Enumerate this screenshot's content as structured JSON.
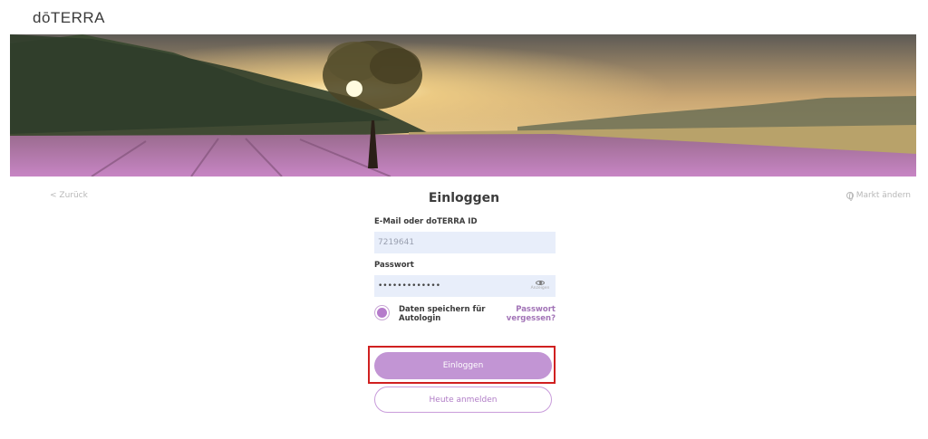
{
  "header": {
    "brand": "dōTERRA"
  },
  "hero": {
    "image": "lavender-field-sunset-tree"
  },
  "nav": {
    "back_label": "< Zurück",
    "market_label": "Markt ändern",
    "market_icon": "globe-icon"
  },
  "page": {
    "title": "Einloggen"
  },
  "form": {
    "email_label": "E-Mail oder doTERRA ID",
    "email_value": "7219641",
    "password_label": "Passwort",
    "password_value": "•••••••••••••",
    "show_label": "Anzeigen",
    "remember_label": "Daten speichern für Autologin",
    "remember_checked": true,
    "forgot_label": "Passwort vergessen?",
    "login_button": "Einloggen",
    "signup_button": "Heute anmelden"
  },
  "colors": {
    "accent": "#c295d4",
    "accent_text": "#a274b7",
    "input_bg": "#e8eefa",
    "highlight": "#d02020"
  }
}
